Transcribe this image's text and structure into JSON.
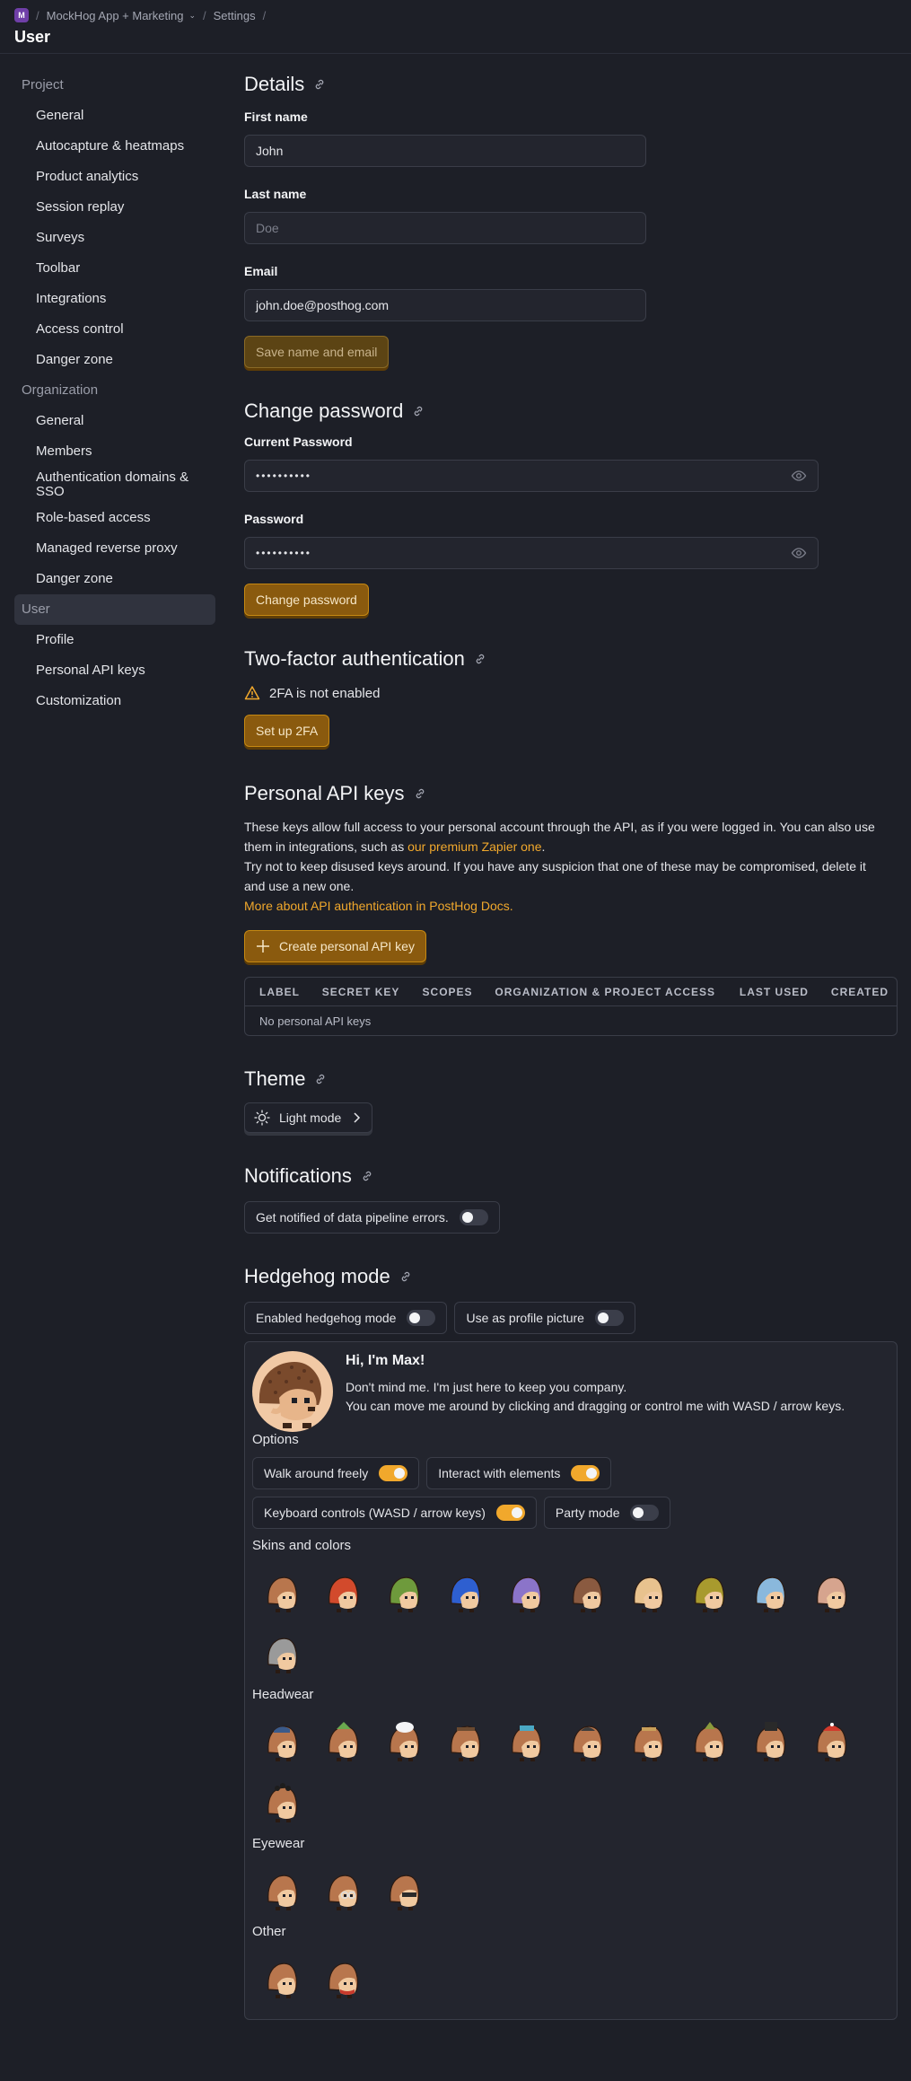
{
  "breadcrumb": {
    "project_icon": "M",
    "project": "MockHog App + Marketing",
    "settings": "Settings",
    "page_title": "User"
  },
  "sidebar": {
    "project_section": "Project",
    "project_items": [
      "General",
      "Autocapture & heatmaps",
      "Product analytics",
      "Session replay",
      "Surveys",
      "Toolbar",
      "Integrations",
      "Access control",
      "Danger zone"
    ],
    "org_section": "Organization",
    "org_items": [
      "General",
      "Members",
      "Authentication domains & SSO",
      "Role-based access",
      "Managed reverse proxy",
      "Danger zone"
    ],
    "user_section": "User",
    "user_items": [
      "Profile",
      "Personal API keys",
      "Customization"
    ]
  },
  "details": {
    "title": "Details",
    "first_name_label": "First name",
    "first_name_value": "John",
    "last_name_label": "Last name",
    "last_name_placeholder": "Doe",
    "email_label": "Email",
    "email_value": "john.doe@posthog.com",
    "save_button": "Save name and email"
  },
  "password": {
    "title": "Change password",
    "current_label": "Current Password",
    "current_value": "••••••••••",
    "new_label": "Password",
    "new_value": "••••••••••",
    "button": "Change password"
  },
  "twofa": {
    "title": "Two-factor authentication",
    "status": "2FA is not enabled",
    "button": "Set up 2FA"
  },
  "api_keys": {
    "title": "Personal API keys",
    "para1_a": "These keys allow full access to your personal account through the API, as if you were logged in. You can also use them in integrations, such as ",
    "para1_link": "our premium Zapier one",
    "para1_b": ".",
    "para2": "Try not to keep disused keys around. If you have any suspicion that one of these may be compromised, delete it and use a new one.",
    "docs_link": "More about API authentication in PostHog Docs.",
    "create_button": "Create personal API key",
    "columns": [
      "LABEL",
      "SECRET KEY",
      "SCOPES",
      "ORGANIZATION & PROJECT ACCESS",
      "LAST USED",
      "CREATED"
    ],
    "empty": "No personal API keys"
  },
  "theme": {
    "title": "Theme",
    "value": "Light mode"
  },
  "notifications": {
    "title": "Notifications",
    "toggle_label": "Get notified of data pipeline errors."
  },
  "hedgehog": {
    "title": "Hedgehog mode",
    "enabled_label": "Enabled hedgehog mode",
    "profile_label": "Use as profile picture",
    "greeting": "Hi, I'm Max!",
    "line1": "Don't mind me. I'm just here to keep you company.",
    "line2": "You can move me around by clicking and dragging or control me with WASD / arrow keys.",
    "options_label": "Options",
    "opt_walk": "Walk around freely",
    "opt_interact": "Interact with elements",
    "opt_keyboard": "Keyboard controls (WASD / arrow keys)",
    "opt_party": "Party mode",
    "skins_label": "Skins and colors",
    "headwear_label": "Headwear",
    "eyewear_label": "Eyewear",
    "other_label": "Other",
    "skin_colors": [
      "#b8764d",
      "#d24a2c",
      "#6e9a3c",
      "#2e5fd0",
      "#8b74c9",
      "#8a5a40",
      "#e8c28e",
      "#a89a2e",
      "#8ab8dc",
      "#d6a48e",
      "#9a9a9a"
    ],
    "accent": "#f1a82c"
  }
}
